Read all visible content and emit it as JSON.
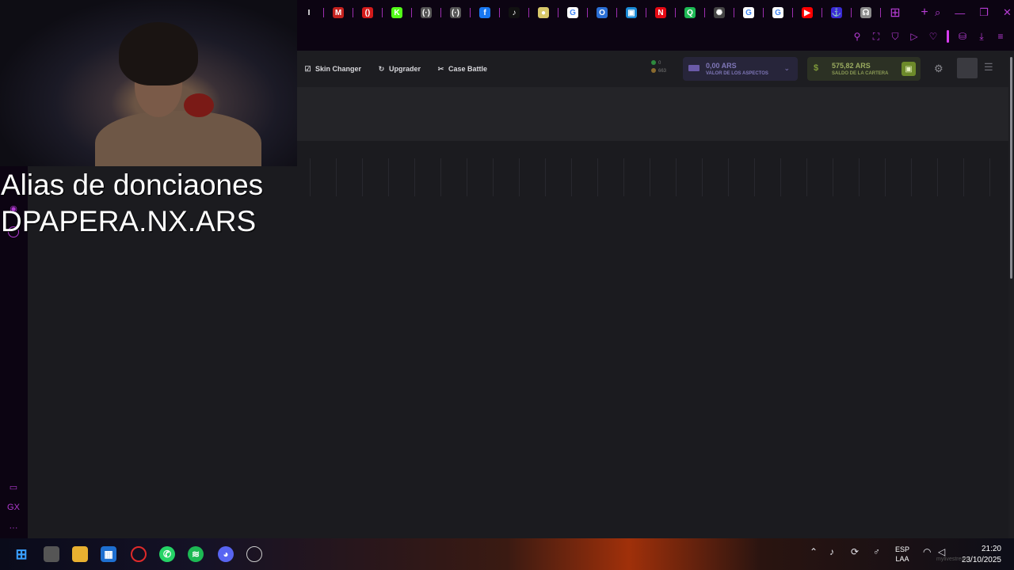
{
  "browser": {
    "tabs": [
      {
        "icon": "generic-tab-icon",
        "color": "#0c0412",
        "glyph": "I"
      },
      {
        "icon": "gmail-icon",
        "color": "#c5221f",
        "glyph": "M"
      },
      {
        "icon": "opera-gx-icon",
        "color": "#d31a1a",
        "glyph": "()"
      },
      {
        "icon": "kick-icon",
        "color": "#53fc18",
        "glyph": "K"
      },
      {
        "icon": "link-icon",
        "color": "#555555",
        "glyph": "(·)"
      },
      {
        "icon": "link-icon",
        "color": "#555555",
        "glyph": "(·)"
      },
      {
        "icon": "facebook-icon",
        "color": "#1877f2",
        "glyph": "f"
      },
      {
        "icon": "tiktok-icon",
        "color": "#111111",
        "glyph": "♪"
      },
      {
        "icon": "generic-tab-icon",
        "color": "#d8c86a",
        "glyph": "●"
      },
      {
        "icon": "google-icon",
        "color": "#ffffff",
        "glyph": "G"
      },
      {
        "icon": "tab-o-icon",
        "color": "#2b6fd6",
        "glyph": "O"
      },
      {
        "icon": "tab-blue-icon",
        "color": "#1a8ad6",
        "glyph": "▣"
      },
      {
        "icon": "netflix-icon",
        "color": "#e50914",
        "glyph": "N"
      },
      {
        "icon": "tab-green-icon",
        "color": "#1db954",
        "glyph": "Q"
      },
      {
        "icon": "openai-icon",
        "color": "#444444",
        "glyph": "✺"
      },
      {
        "icon": "google-icon",
        "color": "#ffffff",
        "glyph": "G"
      },
      {
        "icon": "google-icon",
        "color": "#ffffff",
        "glyph": "G"
      },
      {
        "icon": "youtube-icon",
        "color": "#ff0000",
        "glyph": "▶"
      },
      {
        "icon": "anchor-icon",
        "color": "#3a2ad6",
        "glyph": "⚓"
      },
      {
        "icon": "headset-icon",
        "color": "#8b8b8b",
        "glyph": "☊"
      }
    ],
    "tab_grid_icon": "⊞",
    "new_tab_icon": "+"
  },
  "window_controls": {
    "search": "⌕",
    "minimize": "—",
    "restore": "❐",
    "close": "✕"
  },
  "toolbar_tools": [
    {
      "name": "pin-icon",
      "glyph": "⚲"
    },
    {
      "name": "snapshot-icon",
      "glyph": "⛶"
    },
    {
      "name": "shield-icon",
      "glyph": "⛉"
    },
    {
      "name": "send-icon",
      "glyph": "▷"
    },
    {
      "name": "heart-icon",
      "glyph": "♡"
    },
    {
      "name": "bag-icon",
      "glyph": "⛁"
    },
    {
      "name": "download-icon",
      "glyph": "⤓"
    },
    {
      "name": "menu-icon",
      "glyph": "≡"
    }
  ],
  "nav": [
    {
      "icon": "☑",
      "label": "Skin Changer"
    },
    {
      "icon": "↻",
      "label": "Upgrader"
    },
    {
      "icon": "✂",
      "label": "Case Battle"
    }
  ],
  "status": {
    "online": "0",
    "players": "663"
  },
  "inventory_value": {
    "amount": "0,00 ARS",
    "label": "VALOR DE LOS ASPECTOS"
  },
  "wallet": {
    "amount": "575,82 ARS",
    "label": "SALDO DE LA CARTERA"
  },
  "overlay": {
    "line1": "Alias de donciaones",
    "line2": "DPAPERA.NX.ARS"
  },
  "taskbar": {
    "language": "ESP",
    "layout": "LAA",
    "time": "21:20",
    "date": "23/10/2025"
  },
  "watermark": "mylivestream"
}
